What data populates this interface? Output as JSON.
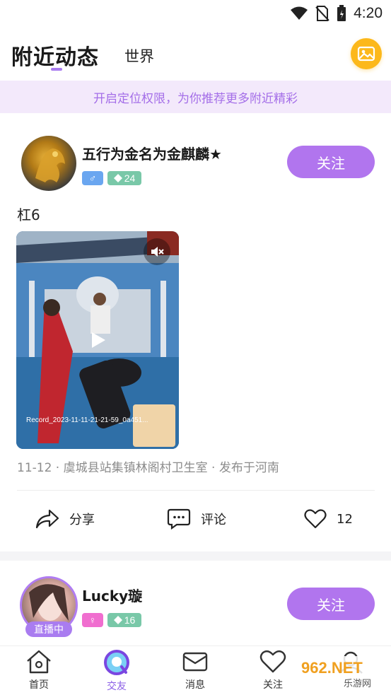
{
  "status_bar": {
    "time": "4:20"
  },
  "header": {
    "active_tab": "附近动态",
    "other_tab": "世界"
  },
  "banner": {
    "text": "开启定位权限，为你推荐更多附近精彩"
  },
  "posts": [
    {
      "username": "五行为金名为金麒麟★",
      "gender_symbol": "♂",
      "level": "24",
      "follow_label": "关注",
      "text": "杠6",
      "meta": "11-12 · 虞城县站集镇林阁村卫生室 · 发布于河南",
      "share_label": "分享",
      "comment_label": "评论",
      "likes": "12",
      "video_overlay": {
        "record_text": "Record_2023-11-11-21-21-59_0a451..."
      }
    },
    {
      "username": "Lucky璇",
      "gender_symbol": "♀",
      "level": "16",
      "follow_label": "关注",
      "live_tag": "直播中"
    }
  ],
  "bottom_nav": [
    {
      "label": "首页",
      "icon": "home-icon"
    },
    {
      "label": "交友",
      "icon": "chat-bubble-icon",
      "active": true
    },
    {
      "label": "消息",
      "icon": "mail-icon"
    },
    {
      "label": "关注",
      "icon": "heart-icon"
    },
    {
      "label": "",
      "icon": "profile-icon"
    }
  ],
  "watermark": {
    "text": "962.NET",
    "subtext": "乐游网"
  },
  "colors": {
    "accent_purple": "#b175ee",
    "banner_bg": "#f3e9fb",
    "banner_text": "#a46ee8",
    "gallery_button": "#fcb81b",
    "male_badge": "#6aa6f0",
    "female_badge": "#f06ecf",
    "level_badge": "#79c8a8"
  }
}
